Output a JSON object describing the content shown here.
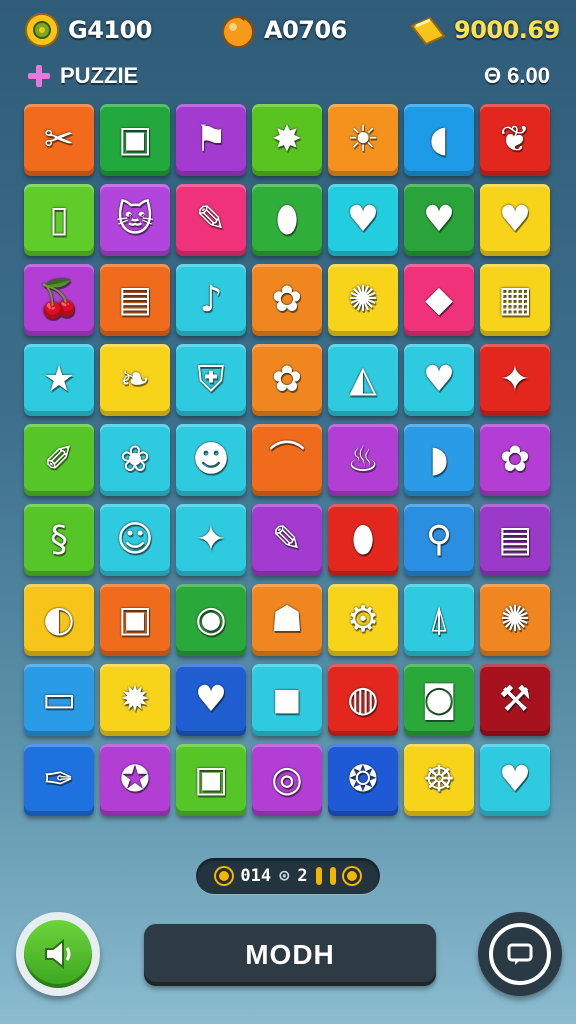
{
  "hud": {
    "coins": {
      "value": "G4100",
      "icon": "flower-coin-icon"
    },
    "orb": {
      "value": "A0706",
      "icon": "orange-orb-icon"
    },
    "gold": {
      "value": "9000.69",
      "icon": "gold-bar-icon"
    },
    "mode_label": "PUZZIE",
    "timer": "Θ 6.00"
  },
  "grid": {
    "columns": 7,
    "rows": [
      [
        {
          "color": "#f26a1b",
          "icon": "✂"
        },
        {
          "color": "#22a83c",
          "icon": "▣"
        },
        {
          "color": "#a43bd0",
          "icon": "⚑"
        },
        {
          "color": "#59c320",
          "icon": "✸"
        },
        {
          "color": "#f5921e",
          "icon": "☀"
        },
        {
          "color": "#1e9be6",
          "icon": "◖"
        },
        {
          "color": "#e3261e",
          "icon": "❦"
        }
      ],
      [
        {
          "color": "#5fcc2a",
          "icon": "▯"
        },
        {
          "color": "#b246dc",
          "icon": "🐱"
        },
        {
          "color": "#f0327a",
          "icon": "✎"
        },
        {
          "color": "#2fae3a",
          "icon": "⬮"
        },
        {
          "color": "#22cde0",
          "icon": "♥"
        },
        {
          "color": "#2aa33a",
          "icon": "♥"
        },
        {
          "color": "#f7d31a",
          "icon": "♥"
        }
      ],
      [
        {
          "color": "#b23ed4",
          "icon": "🍒"
        },
        {
          "color": "#f06c1c",
          "icon": "▤"
        },
        {
          "color": "#2ecbe0",
          "icon": "♪"
        },
        {
          "color": "#f08620",
          "icon": "✿"
        },
        {
          "color": "#f7d31a",
          "icon": "✺"
        },
        {
          "color": "#f0327a",
          "icon": "◆"
        },
        {
          "color": "#f7d31a",
          "icon": "▦"
        }
      ],
      [
        {
          "color": "#2ecbe0",
          "icon": "★"
        },
        {
          "color": "#f7d31a",
          "icon": "❧"
        },
        {
          "color": "#2ecbe0",
          "icon": "⛨"
        },
        {
          "color": "#f08620",
          "icon": "✿"
        },
        {
          "color": "#2ecbe0",
          "icon": "◭"
        },
        {
          "color": "#2ecbe0",
          "icon": "♥"
        },
        {
          "color": "#e3261e",
          "icon": "✦"
        }
      ],
      [
        {
          "color": "#55c528",
          "icon": "✐"
        },
        {
          "color": "#2ecbe0",
          "icon": "❀"
        },
        {
          "color": "#2ecbe0",
          "icon": "☻"
        },
        {
          "color": "#f06c1c",
          "icon": "⌒"
        },
        {
          "color": "#b23ed4",
          "icon": "♨"
        },
        {
          "color": "#2a9be6",
          "icon": "◗"
        },
        {
          "color": "#b23ed4",
          "icon": "✿"
        }
      ],
      [
        {
          "color": "#55c528",
          "icon": "§"
        },
        {
          "color": "#2ecbe0",
          "icon": "☺"
        },
        {
          "color": "#2ecbe0",
          "icon": "✦"
        },
        {
          "color": "#a43bd0",
          "icon": "✎"
        },
        {
          "color": "#e3261e",
          "icon": "⬮"
        },
        {
          "color": "#2a8fe0",
          "icon": "⚲"
        },
        {
          "color": "#9b3ac8",
          "icon": "▤"
        }
      ],
      [
        {
          "color": "#f7c51a",
          "icon": "◐"
        },
        {
          "color": "#f06c1c",
          "icon": "▣"
        },
        {
          "color": "#2aa83a",
          "icon": "◉"
        },
        {
          "color": "#f08620",
          "icon": "☗"
        },
        {
          "color": "#f7d31a",
          "icon": "⚙"
        },
        {
          "color": "#2ecbe0",
          "icon": "⍋"
        },
        {
          "color": "#f08620",
          "icon": "✺"
        }
      ],
      [
        {
          "color": "#2a9be6",
          "icon": "▭"
        },
        {
          "color": "#f7d31a",
          "icon": "✹"
        },
        {
          "color": "#1f5ed0",
          "icon": "♥"
        },
        {
          "color": "#2ecbe0",
          "icon": "◼"
        },
        {
          "color": "#e3261e",
          "icon": "◍"
        },
        {
          "color": "#2aa83a",
          "icon": "◙"
        },
        {
          "color": "#a8121e",
          "icon": "⚒"
        }
      ],
      [
        {
          "color": "#1e72e0",
          "icon": "✑"
        },
        {
          "color": "#b23ed4",
          "icon": "✪"
        },
        {
          "color": "#55c528",
          "icon": "▣"
        },
        {
          "color": "#b23ed4",
          "icon": "◎"
        },
        {
          "color": "#1e5ad6",
          "icon": "❂"
        },
        {
          "color": "#f7d31a",
          "icon": "☸"
        },
        {
          "color": "#2ecbe0",
          "icon": "♥"
        }
      ]
    ]
  },
  "counter": {
    "left": "014",
    "right": "2"
  },
  "buttons": {
    "sound": {
      "icon": "speaker-icon"
    },
    "main_label": "MODH",
    "menu": {
      "icon": "chat-icon"
    }
  }
}
